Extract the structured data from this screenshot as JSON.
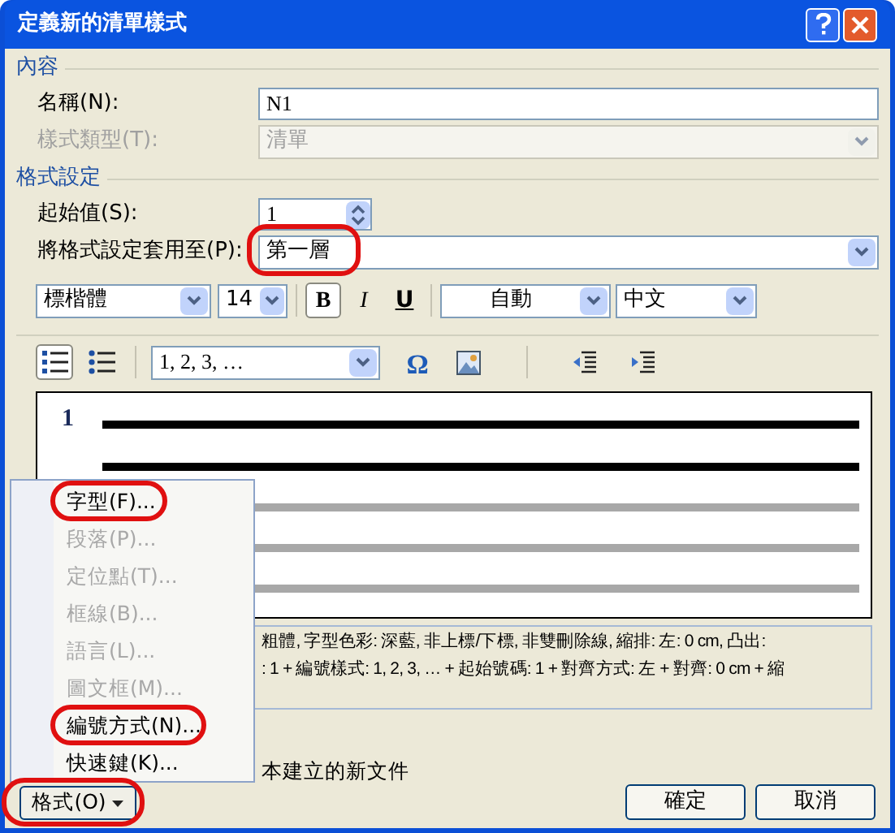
{
  "window": {
    "title": "定義新的清單樣式"
  },
  "content": {
    "heading": "內容",
    "name": {
      "label": "名稱(N):",
      "value": "N1"
    },
    "style_type": {
      "label": "樣式類型(T):",
      "value": "清單",
      "disabled": true
    }
  },
  "format": {
    "heading": "格式設定",
    "start": {
      "label": "起始值(S):",
      "value": "1"
    },
    "apply_to": {
      "label": "將格式設定套用至(P):",
      "value": "第一層"
    },
    "font": "標楷體",
    "size": "14",
    "style_buttons": [
      {
        "kind": "bold",
        "label": "B",
        "selected": true
      },
      {
        "kind": "italic",
        "label": "I",
        "selected": false
      },
      {
        "kind": "underline",
        "label": "U",
        "selected": false
      }
    ],
    "font_color": "自動",
    "language": "中文",
    "list_buttons": [
      {
        "kind": "numbered",
        "selected": true
      },
      {
        "kind": "bulleted",
        "selected": false
      }
    ],
    "number_style": "1, 2, 3, …",
    "symbol_button": "Ω",
    "preview_number": "1",
    "description": [
      "粗體, 字型色彩: 深藍, 非上標/下標, 非雙刪除線, 縮排: 左: 0 cm, 凸出:",
      ": 1 + 編號樣式: 1, 2, 3, … + 起始號碼: 1 + 對齊方式: 左 + 對齊: 0 cm + 縮"
    ],
    "option_text": "本建立的新文件"
  },
  "menu": [
    {
      "label": "字型(F)...",
      "disabled": false,
      "circled": true
    },
    {
      "label": "段落(P)...",
      "disabled": true,
      "circled": false
    },
    {
      "label": "定位點(T)...",
      "disabled": true,
      "circled": false
    },
    {
      "label": "框線(B)...",
      "disabled": true,
      "circled": false
    },
    {
      "label": "語言(L)...",
      "disabled": true,
      "circled": false
    },
    {
      "label": "圖文框(M)...",
      "disabled": true,
      "circled": false
    },
    {
      "label": "編號方式(N)...",
      "disabled": false,
      "circled": true
    },
    {
      "label": "快速鍵(K)...",
      "disabled": false,
      "circled": false
    }
  ],
  "format_button": {
    "label": "格式(O)"
  },
  "buttons": [
    "確定",
    "取消"
  ]
}
